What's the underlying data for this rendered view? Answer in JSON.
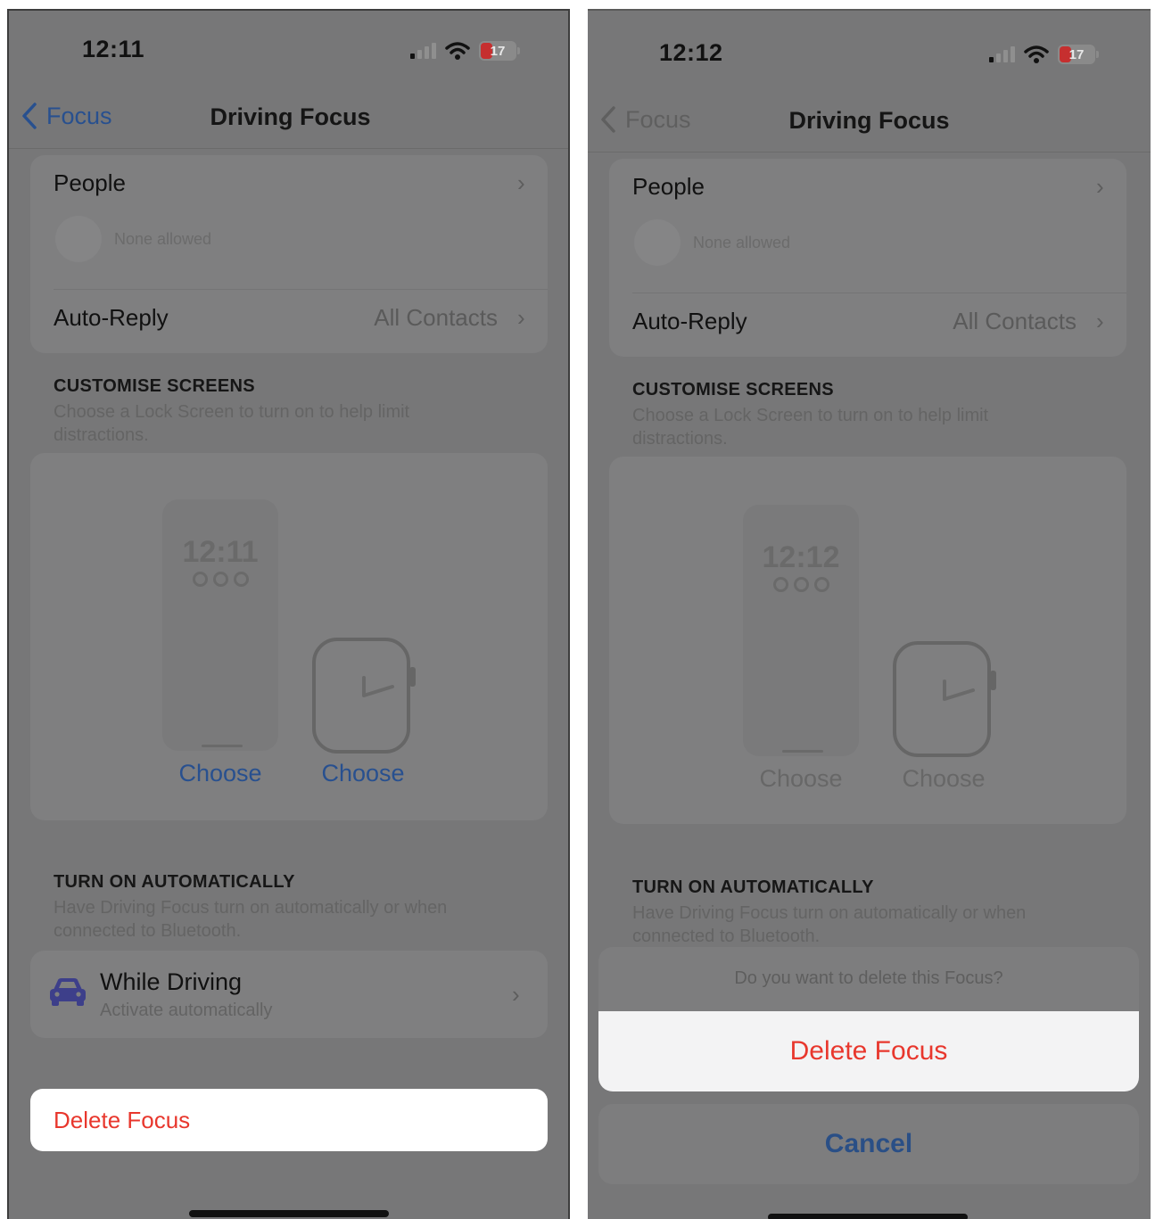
{
  "colors": {
    "dim_background": "#777778",
    "card": "#7f7f80",
    "accent_blue": "#28508f",
    "destructive_red": "#e8372d",
    "battery_low": "#c62f2f"
  },
  "left": {
    "status_bar": {
      "time": "12:11",
      "battery": "17",
      "signal_bars_active": 1,
      "wifi": "wifi-icon"
    },
    "nav": {
      "back_label": "Focus",
      "title": "Driving Focus"
    },
    "people": {
      "label": "People",
      "subtitle": "None allowed"
    },
    "auto_reply": {
      "label": "Auto-Reply",
      "value": "All Contacts"
    },
    "customise": {
      "heading": "CUSTOMISE SCREENS",
      "desc_line1": "Choose a Lock Screen to turn on to help limit",
      "desc_line2": "distractions.",
      "lock_time": "12:11",
      "choose_lock": "Choose",
      "choose_watch": "Choose"
    },
    "auto": {
      "heading": "TURN ON AUTOMATICALLY",
      "desc_line1": "Have Driving Focus turn on automatically or when",
      "desc_line2": "connected to Bluetooth.",
      "item_title": "While Driving",
      "item_subtitle": "Activate automatically",
      "item_icon": "car-icon"
    },
    "delete_label": "Delete Focus"
  },
  "right": {
    "status_bar": {
      "time": "12:12",
      "battery": "17",
      "signal_bars_active": 1,
      "wifi": "wifi-icon"
    },
    "nav": {
      "back_label": "Focus",
      "title": "Driving Focus"
    },
    "people": {
      "label": "People",
      "subtitle": "None allowed"
    },
    "auto_reply": {
      "label": "Auto-Reply",
      "value": "All Contacts"
    },
    "customise": {
      "heading": "CUSTOMISE SCREENS",
      "desc_line1": "Choose a Lock Screen to turn on to help limit",
      "desc_line2": "distractions.",
      "lock_time": "12:12",
      "choose_lock": "Choose",
      "choose_watch": "Choose"
    },
    "auto": {
      "heading": "TURN ON AUTOMATICALLY",
      "desc_line1": "Have Driving Focus turn on automatically or when",
      "desc_line2": "connected to Bluetooth."
    },
    "sheet": {
      "message": "Do you want to delete this Focus?",
      "delete_label": "Delete Focus",
      "cancel_label": "Cancel"
    }
  }
}
